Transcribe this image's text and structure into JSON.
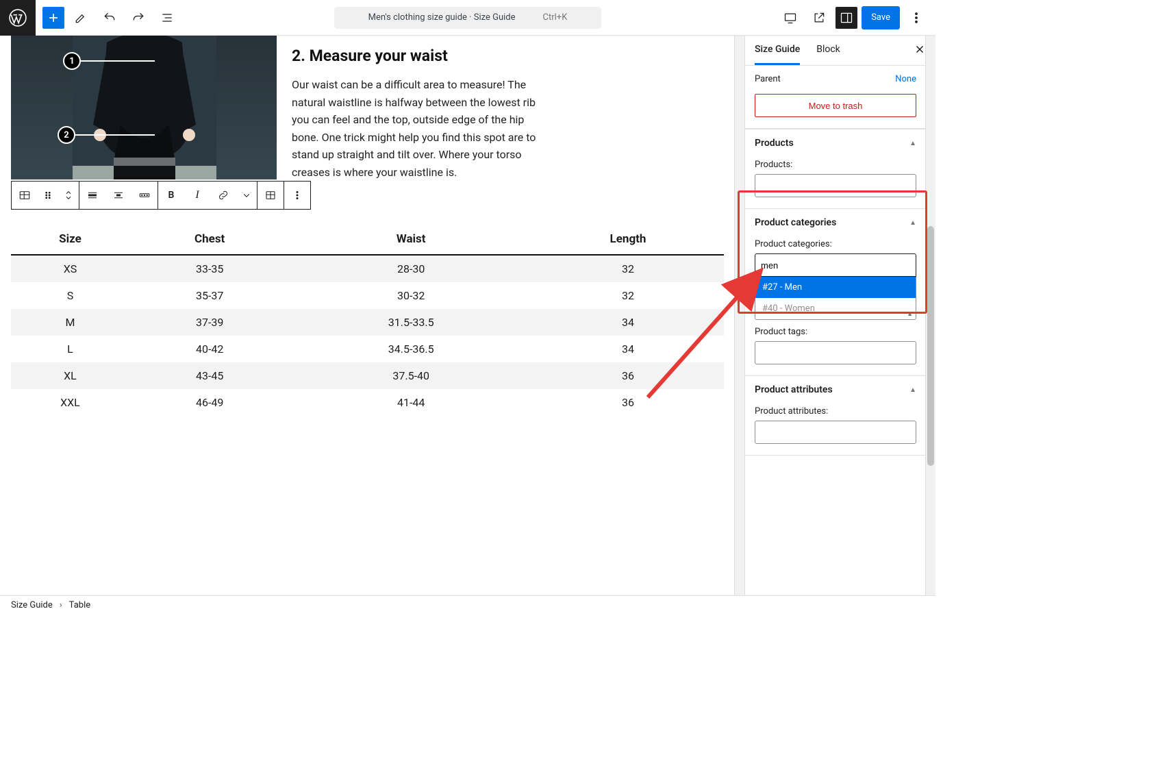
{
  "topbar": {
    "doc_title": "Men's clothing size guide · Size Guide",
    "shortcut": "Ctrl+K",
    "save_label": "Save"
  },
  "hero": {
    "heading": "2. Measure your waist",
    "paragraph": "Our waist can be a difficult area to measure! The natural waistline is halfway between the lowest rib you can feel and the top, outside edge of the hip bone. One trick might help you find this spot are to stand up straight and tilt over. Where your torso creases is where your waistline is.",
    "marker1": "1",
    "marker2": "2"
  },
  "block_toolbar": {
    "bold": "B",
    "italic": "I"
  },
  "chart_data": {
    "type": "table",
    "columns": [
      "Size",
      "Chest",
      "Waist",
      "Length"
    ],
    "rows": [
      [
        "XS",
        "33-35",
        "28-30",
        "32"
      ],
      [
        "S",
        "35-37",
        "30-32",
        "32"
      ],
      [
        "M",
        "37-39",
        "31.5-33.5",
        "34"
      ],
      [
        "L",
        "40-42",
        "34.5-36.5",
        "34"
      ],
      [
        "XL",
        "43-45",
        "37.5-40",
        "36"
      ],
      [
        "XXL",
        "46-49",
        "41-44",
        "36"
      ]
    ]
  },
  "sidebar": {
    "tabs": {
      "guide": "Size Guide",
      "block": "Block"
    },
    "parent": {
      "label": "Parent",
      "value": "None"
    },
    "trash": "Move to trash",
    "panels": {
      "products": {
        "title": "Products",
        "field_label": "Products:"
      },
      "categories": {
        "title": "Product categories",
        "field_label": "Product categories:",
        "input_value": "men",
        "options": [
          {
            "label": "#27 - Men",
            "selected": true
          },
          {
            "label": "#40 - Women",
            "selected": false
          }
        ]
      },
      "tags": {
        "title_hidden": "",
        "field_label": "Product tags:"
      },
      "attributes": {
        "title": "Product attributes",
        "field_label": "Product attributes:"
      }
    }
  },
  "footer": {
    "crumb1": "Size Guide",
    "crumb2": "Table"
  }
}
